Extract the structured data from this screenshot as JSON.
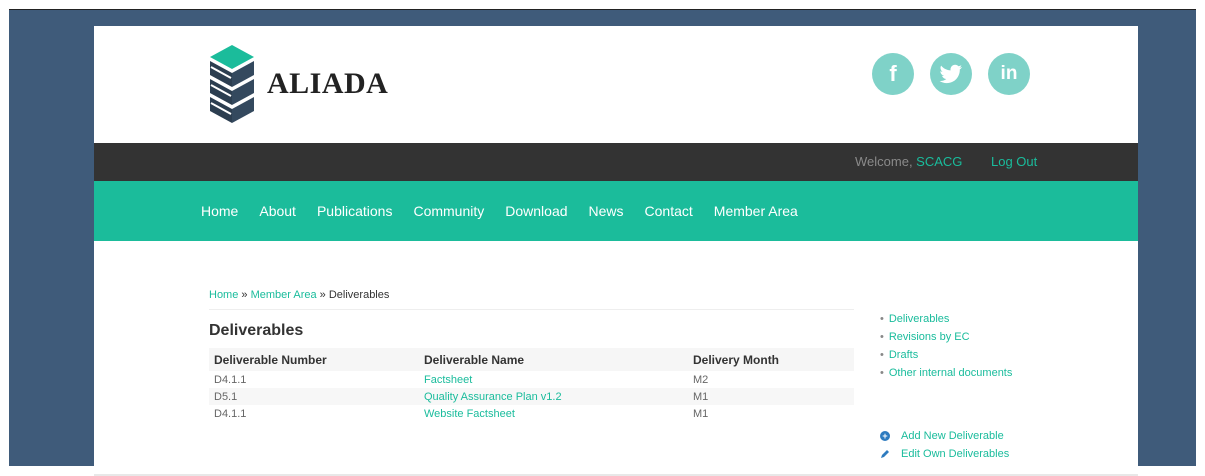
{
  "header": {
    "logo_text": "ALIADA",
    "social": {
      "facebook": "f",
      "linkedin": "in"
    }
  },
  "topbar": {
    "welcome_prefix": "Welcome, ",
    "username": "SCACG",
    "logout_label": "Log Out"
  },
  "nav": {
    "items": [
      "Home",
      "About",
      "Publications",
      "Community",
      "Download",
      "News",
      "Contact",
      "Member Area"
    ]
  },
  "breadcrumb": {
    "home": "Home",
    "sep1": " » ",
    "member_area": "Member Area",
    "sep2": " » ",
    "current": "Deliverables"
  },
  "main": {
    "heading": "Deliverables",
    "table": {
      "headers": [
        "Deliverable Number",
        "Deliverable Name",
        "Delivery Month"
      ],
      "rows": [
        [
          "D4.1.1",
          "Factsheet",
          "M2"
        ],
        [
          "D5.1",
          "Quality Assurance Plan v1.2",
          "M1"
        ],
        [
          "D4.1.1",
          "Website Factsheet",
          "M1"
        ]
      ]
    }
  },
  "sidebar": {
    "links": [
      "Deliverables",
      "Revisions by EC",
      "Drafts",
      "Other internal documents"
    ],
    "add_label": "Add New Deliverable",
    "edit_label": "Edit Own Deliverables"
  },
  "colors": {
    "accent": "#1bbc9b",
    "topbar": "#333333",
    "frame": "#3f5b7a",
    "social": "#7fd2c8"
  }
}
